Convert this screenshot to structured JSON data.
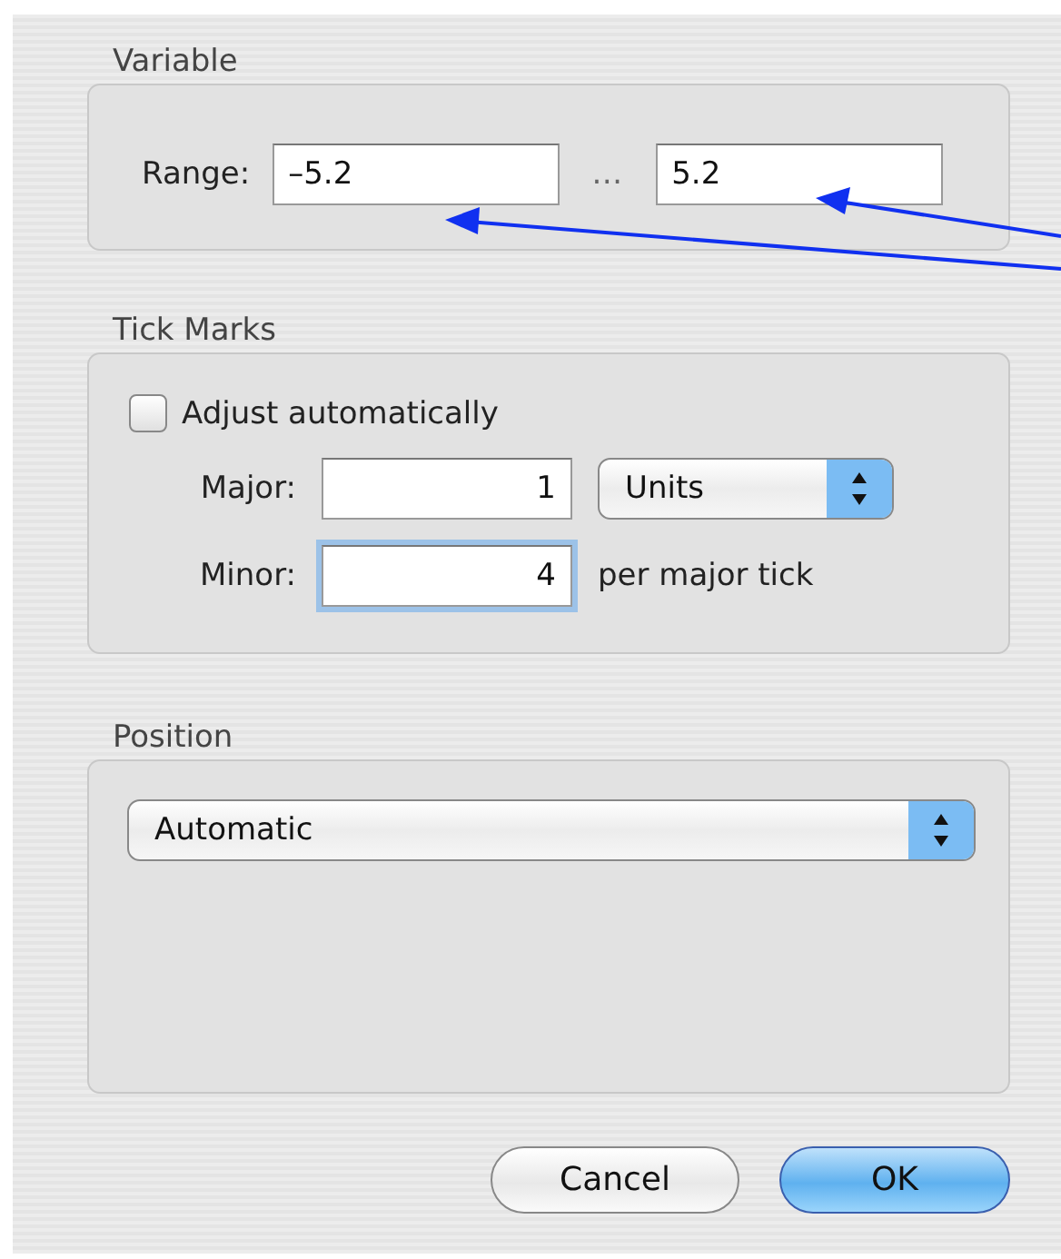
{
  "groups": [
    {
      "kind": "range",
      "title": "Variable",
      "label": "Range:",
      "from": "–5.2",
      "separator": "…",
      "to": "5.2"
    },
    {
      "kind": "ticks",
      "title": "Tick Marks",
      "checkbox": {
        "label": "Adjust automatically",
        "checked": false
      },
      "major": {
        "label": "Major:",
        "value": "1",
        "unit": "Units",
        "focused": false
      },
      "minor": {
        "label": "Minor:",
        "value": "4",
        "suffix": "per major tick",
        "focused": true
      }
    },
    {
      "kind": "position",
      "title": "Position",
      "popup": "Automatic"
    }
  ],
  "buttons": [
    {
      "label": "Cancel",
      "default": false
    },
    {
      "label": "OK",
      "default": true
    }
  ]
}
